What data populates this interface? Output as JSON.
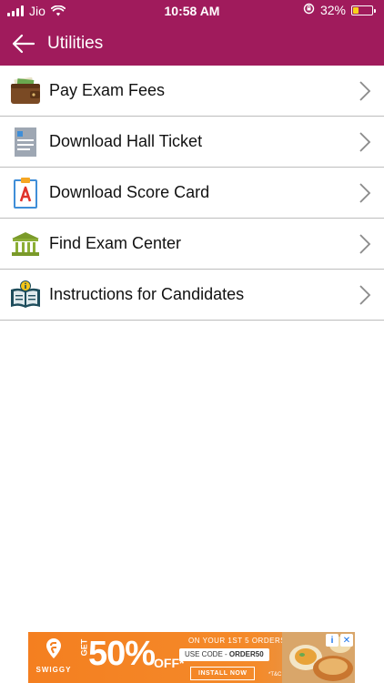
{
  "status_bar": {
    "carrier": "Jio",
    "time": "10:58 AM",
    "battery_percent": "32%",
    "battery_level": 0.32
  },
  "nav": {
    "title": "Utilities"
  },
  "menu": {
    "items": [
      {
        "label": "Pay Exam Fees",
        "icon": "wallet-icon"
      },
      {
        "label": "Download Hall Ticket",
        "icon": "document-icon"
      },
      {
        "label": "Download Score Card",
        "icon": "score-card-icon"
      },
      {
        "label": "Find Exam Center",
        "icon": "building-icon"
      },
      {
        "label": "Instructions for Candidates",
        "icon": "book-info-icon"
      }
    ]
  },
  "ad": {
    "brand": "SWIGGY",
    "get": "GET",
    "percent": "50%",
    "off": "OFF*",
    "tagline": "ON YOUR 1ST 5 ORDERS",
    "code_label": "USE CODE -",
    "code": "ORDER50",
    "install_label": "INSTALL NOW",
    "tc": "*T&C",
    "accent_color": "#f47f20"
  },
  "colors": {
    "header": "#a01b5c"
  }
}
